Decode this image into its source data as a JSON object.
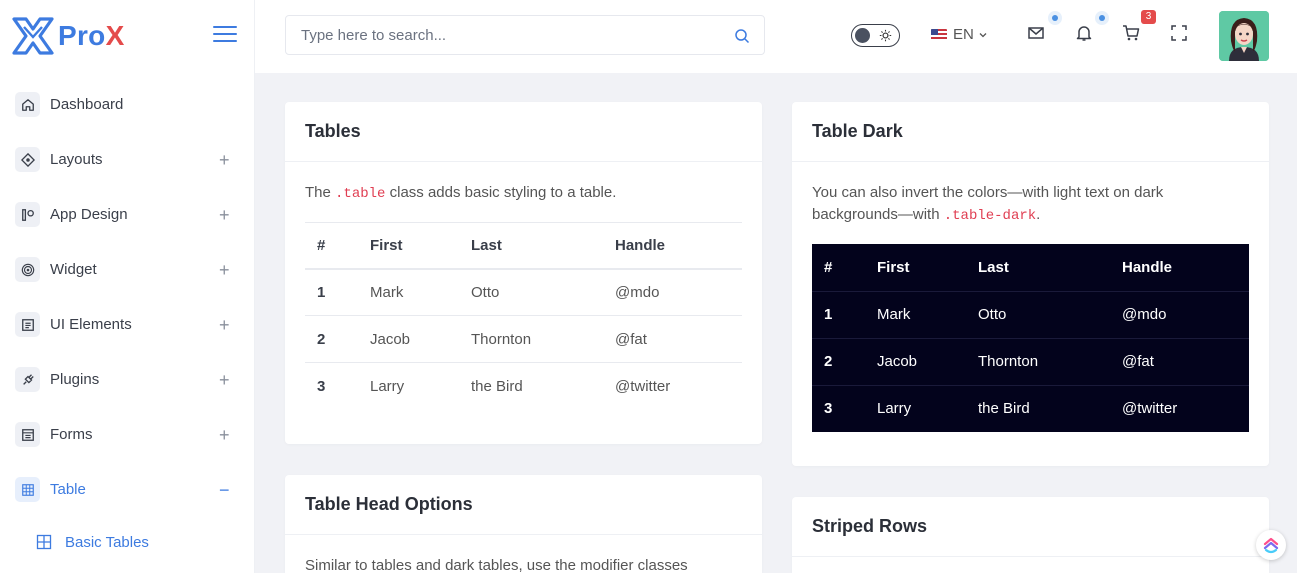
{
  "brand": {
    "part1": "Pro",
    "part2": "X"
  },
  "search": {
    "placeholder": "Type here to search..."
  },
  "topbar": {
    "language": "EN",
    "cart_count": "3"
  },
  "sidebar": {
    "items": [
      {
        "label": "Dashboard"
      },
      {
        "label": "Layouts"
      },
      {
        "label": "App Design"
      },
      {
        "label": "Widget"
      },
      {
        "label": "UI Elements"
      },
      {
        "label": "Plugins"
      },
      {
        "label": "Forms"
      },
      {
        "label": "Table"
      }
    ],
    "expand_symbol": "+",
    "collapse_symbol": "−",
    "sub_items": [
      {
        "label": "Basic Tables"
      }
    ]
  },
  "cards": {
    "tables": {
      "title": "Tables",
      "desc_before": "The ",
      "desc_code": ".table",
      "desc_after": " class adds basic styling to a table."
    },
    "table_dark": {
      "title": "Table Dark",
      "desc_before": "You can also invert the colors—with light text on dark backgrounds—with ",
      "desc_code": ".table-dark",
      "desc_after": "."
    },
    "table_head": {
      "title": "Table Head Options",
      "desc": "Similar to tables and dark tables, use the modifier classes"
    },
    "striped": {
      "title": "Striped Rows"
    }
  },
  "table": {
    "headers": [
      "#",
      "First",
      "Last",
      "Handle"
    ],
    "rows": [
      [
        "1",
        "Mark",
        "Otto",
        "@mdo"
      ],
      [
        "2",
        "Jacob",
        "Thornton",
        "@fat"
      ],
      [
        "3",
        "Larry",
        "the Bird",
        "@twitter"
      ]
    ]
  },
  "colors": {
    "accent": "#3d7be0",
    "brand_red": "#e44b4b",
    "dark_table": "#03031c",
    "code": "#e03e52"
  },
  "icons": [
    "home-icon",
    "layouts-icon",
    "app-design-icon",
    "widget-icon",
    "ui-elements-icon",
    "plugins-icon",
    "forms-icon",
    "table-icon",
    "search-icon",
    "sun-icon",
    "mail-icon",
    "bell-icon",
    "cart-icon",
    "fullscreen-icon",
    "clickup-icon"
  ]
}
